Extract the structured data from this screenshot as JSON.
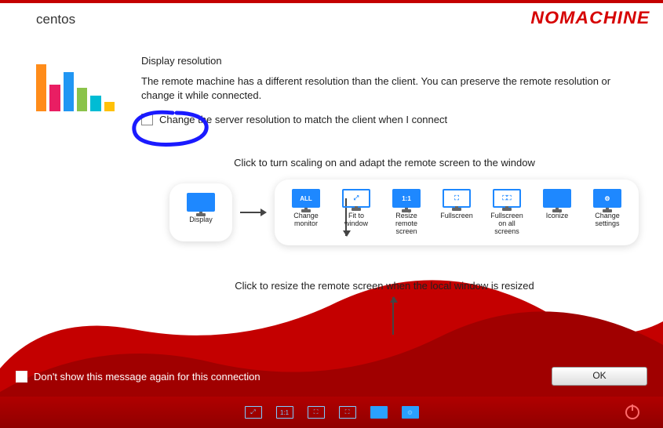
{
  "header": {
    "session": "centos",
    "brand": "NOMACHINE"
  },
  "body": {
    "title": "Display resolution",
    "desc": "The remote machine has a different resolution than the client. You can preserve the remote resolution or change it while connected.",
    "match_checkbox_label": "Change the server resolution to match the client when I connect"
  },
  "diagram": {
    "top_caption": "Click to turn scaling on and adapt the remote screen to the window",
    "bottom_caption": "Click to resize the remote screen when the local window is resized",
    "display_tile": "Display",
    "tiles": [
      {
        "label": "Change monitor",
        "badge": "ALL"
      },
      {
        "label": "Fit to window",
        "badge": "⤢"
      },
      {
        "label": "Resize remote screen",
        "badge": "1:1"
      },
      {
        "label": "Fullscreen",
        "badge": "⛶"
      },
      {
        "label": "Fullscreen on all screens",
        "badge": "⛶⛶"
      },
      {
        "label": "Iconize",
        "badge": ""
      },
      {
        "label": "Change settings",
        "badge": "⚙"
      }
    ]
  },
  "footer": {
    "dont_show": "Don't show this message again for this connection",
    "ok": "OK"
  }
}
